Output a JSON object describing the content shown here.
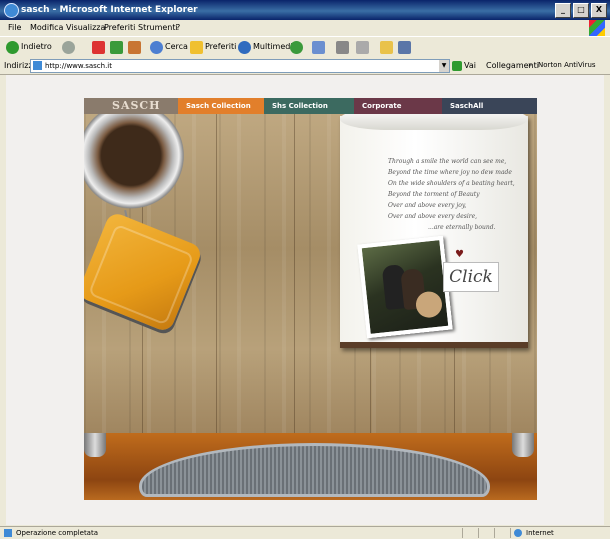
{
  "window": {
    "title": "sasch - Microsoft Internet Explorer",
    "controls": [
      "_",
      "□",
      "X"
    ]
  },
  "menubar": {
    "items": [
      "File",
      "Modifica",
      "Visualizza",
      "Preferiti",
      "Strumenti",
      "?"
    ]
  },
  "toolbar": {
    "back_label": "Indietro",
    "search_label": "Cerca",
    "favorites_label": "Preferiti",
    "media_label": "Multimedia"
  },
  "addressbar": {
    "label": "Indirizzo",
    "url": "http://www.sasch.it",
    "go_label": "Vai",
    "links_label": "Collegamenti",
    "antivirus_label": "Norton AntiVirus"
  },
  "site": {
    "logo": "SASCH",
    "nav": [
      {
        "label": "Sasch Collection",
        "color": "#e27f2b"
      },
      {
        "label": "Shs Collection",
        "color": "#3c6a60"
      },
      {
        "label": "Corporate",
        "color": "#6b3848"
      },
      {
        "label": "SaschAll",
        "color": "#3a4558"
      }
    ],
    "poem": [
      "Through a smile the world can see me,",
      "Beyond the time where joy no dew made",
      "On the wide shoulders of a beating heart,",
      "Beyond the torment of Beauty",
      "Over and above every joy,",
      "Over and above every desire,",
      "...are eternally bound."
    ],
    "click_label": "Click"
  },
  "statusbar": {
    "text": "Operazione completata",
    "zone": "Internet"
  }
}
